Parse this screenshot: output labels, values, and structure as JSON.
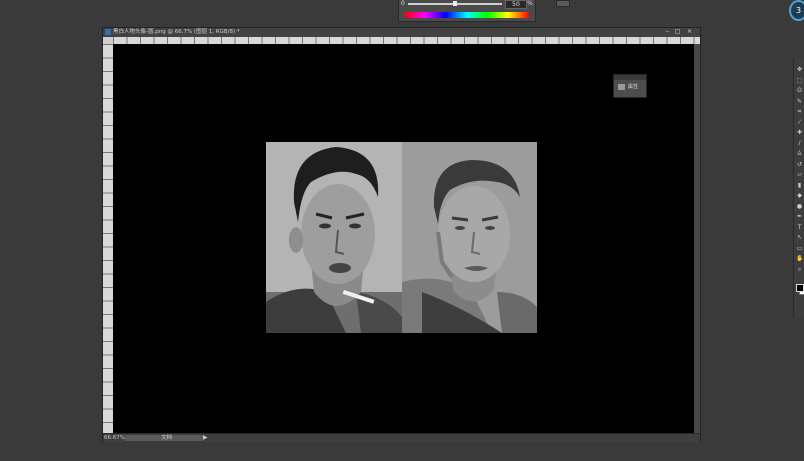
{
  "top_panel": {
    "opacity_min": "0",
    "opacity_value": "50",
    "opacity_unit": "%",
    "opacity_level_percent": 50
  },
  "document": {
    "title": "黑白人物头像-圆.png @ 66.7% (图层 1, RGB/8) *",
    "minimize": "–",
    "maximize": "□",
    "close": "×"
  },
  "status": {
    "zoom": "66.67%",
    "info": "文档",
    "arrow": "▶"
  },
  "mini_panel": {
    "label": "属性"
  },
  "toolbar": {
    "tools": [
      {
        "name": "move-tool-icon",
        "glyph": "✥"
      },
      {
        "name": "marquee-tool-icon",
        "glyph": "⬚"
      },
      {
        "name": "lasso-tool-icon",
        "glyph": "ʘ"
      },
      {
        "name": "quick-select-tool-icon",
        "glyph": "✎"
      },
      {
        "name": "crop-tool-icon",
        "glyph": "⌗"
      },
      {
        "name": "eyedropper-tool-icon",
        "glyph": "⁄"
      },
      {
        "name": "healing-tool-icon",
        "glyph": "✚"
      },
      {
        "name": "brush-tool-icon",
        "glyph": "∕"
      },
      {
        "name": "stamp-tool-icon",
        "glyph": "♙"
      },
      {
        "name": "history-brush-tool-icon",
        "glyph": "↺"
      },
      {
        "name": "eraser-tool-icon",
        "glyph": "▱"
      },
      {
        "name": "gradient-tool-icon",
        "glyph": "▮"
      },
      {
        "name": "blur-tool-icon",
        "glyph": "◆"
      },
      {
        "name": "dodge-tool-icon",
        "glyph": "●"
      },
      {
        "name": "pen-tool-icon",
        "glyph": "✒"
      },
      {
        "name": "type-tool-icon",
        "glyph": "T"
      },
      {
        "name": "path-select-tool-icon",
        "glyph": "↖"
      },
      {
        "name": "shape-tool-icon",
        "glyph": "▭"
      },
      {
        "name": "hand-tool-icon",
        "glyph": "✋"
      },
      {
        "name": "zoom-tool-icon",
        "glyph": "⌕"
      }
    ]
  },
  "colors": {
    "canvas": "#000000",
    "workspace": "#3a3a3a",
    "accent": "#4fa3d4"
  },
  "app_badge": "3"
}
